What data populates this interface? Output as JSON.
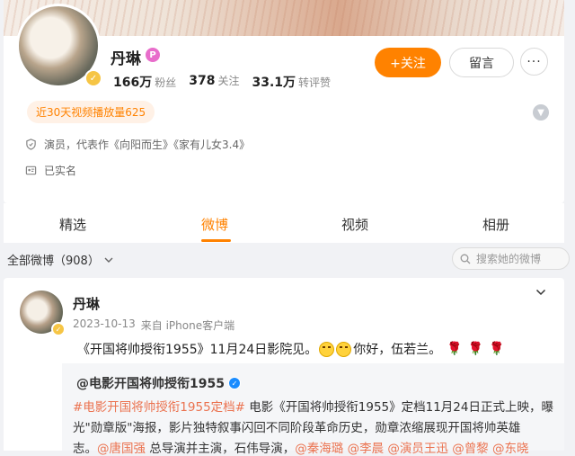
{
  "profile": {
    "name": "丹琳",
    "stats": [
      {
        "value": "166万",
        "label": "粉丝"
      },
      {
        "value": "378",
        "label": "关注"
      },
      {
        "value": "33.1万",
        "label": "转评赞"
      }
    ],
    "follow_label": "+关注",
    "message_label": "留言",
    "more_label": "···",
    "video_views": "近30天视频播放量625",
    "occupation": "演员，代表作《向阳而生》《家有儿女3.4》",
    "verification": "已实名"
  },
  "tabs": [
    {
      "label": "精选",
      "active": false
    },
    {
      "label": "微博",
      "active": true
    },
    {
      "label": "视频",
      "active": false
    },
    {
      "label": "相册",
      "active": false
    }
  ],
  "filter": {
    "label": "全部微博（908）",
    "search_placeholder": "搜索她的微博"
  },
  "post": {
    "author": "丹琳",
    "date": "2023-10-13",
    "source": "来自 iPhone客户端",
    "text_before": "《开国将帅授衔1955》11月24日影院见。",
    "text_after": "你好，伍若兰。",
    "repost": {
      "account": "@电影开国将帅授衔1955",
      "hashtag": "#电影开国将帅授衔1955定档#",
      "line1_rest": " 电影《开国将帅授衔1955》定档11月24日正式上映，曝",
      "line2": "光\"勋章版\"海报，影片独特叙事闪回不同阶段革命历史，勋章浓缩展现开国将帅英雄",
      "line3_prefix": "志。",
      "mention1": "@唐国强",
      "line3_mid": " 总导演并主演，石伟导演，",
      "mention2": "@秦海璐",
      "mention3": "@李晨",
      "mention4": "@演员王迅",
      "mention5": "@曾黎",
      "mention6": "@东晓"
    }
  },
  "colors": {
    "accent": "#ff8200",
    "link": "#eb7350",
    "background": "#f1f2f5"
  }
}
